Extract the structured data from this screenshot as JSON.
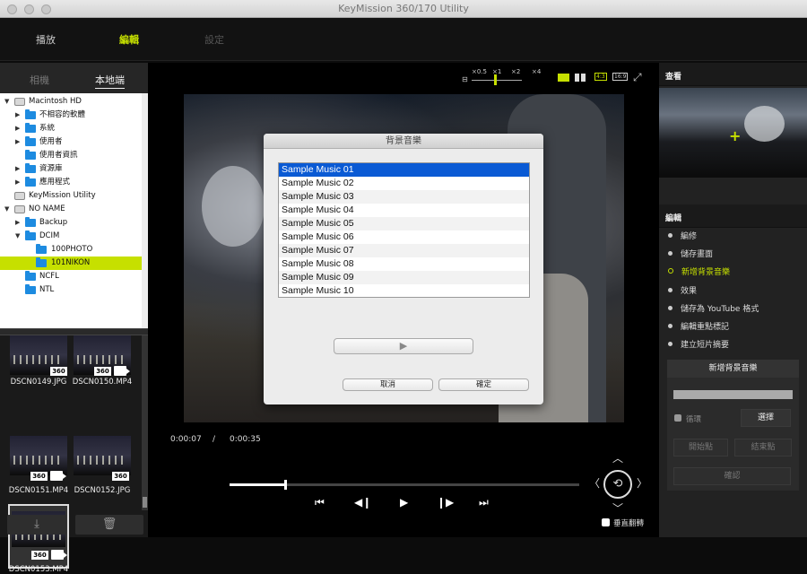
{
  "window": {
    "title": "KeyMission 360/170 Utility"
  },
  "main_tabs": [
    {
      "label": "播放",
      "state": "normal"
    },
    {
      "label": "編輯",
      "state": "active"
    },
    {
      "label": "設定",
      "state": "disabled"
    }
  ],
  "left": {
    "tabs": [
      "相機",
      "本地端"
    ],
    "tree": [
      {
        "label": "Macintosh HD",
        "icon": "drive-icon",
        "expanded": true
      },
      {
        "label": "不相容的軟體",
        "icon": "folder-icon"
      },
      {
        "label": "系統",
        "icon": "folder-icon"
      },
      {
        "label": "使用者",
        "icon": "folder-icon"
      },
      {
        "label": "使用者資訊",
        "icon": "folder-icon"
      },
      {
        "label": "資源庫",
        "icon": "folder-icon"
      },
      {
        "label": "應用程式",
        "icon": "folder-icon"
      },
      {
        "label": "KeyMission Utility",
        "icon": "drive-icon"
      },
      {
        "label": "NO NAME",
        "icon": "drive-icon",
        "expanded": true
      },
      {
        "label": "Backup",
        "icon": "folder-icon"
      },
      {
        "label": "DCIM",
        "icon": "folder-icon",
        "expanded": true
      },
      {
        "label": "100PHOTO",
        "icon": "folder-icon"
      },
      {
        "label": "101NIKON",
        "icon": "folder-icon",
        "selected": true
      },
      {
        "label": "NCFL",
        "icon": "folder-icon"
      },
      {
        "label": "NTL",
        "icon": "folder-icon"
      }
    ],
    "thumbnails": [
      {
        "name": "DSCN0149.JPG",
        "badge": "360",
        "video": false
      },
      {
        "name": "DSCN0150.MP4",
        "badge": "360",
        "video": true
      },
      {
        "name": "DSCN0151.MP4",
        "badge": "360",
        "video": true
      },
      {
        "name": "DSCN0152.JPG",
        "badge": "360",
        "video": false
      },
      {
        "name": "DSCN0153.MP4",
        "badge": "360",
        "video": true,
        "selected": true
      }
    ],
    "import_icon": "download-icon",
    "delete_icon": "trash-icon"
  },
  "viewer": {
    "zoom_labels": [
      "×0.5",
      "×1",
      "×2",
      "×4"
    ],
    "aspect_labels": [
      "4:3",
      "16:9"
    ],
    "time_current": "0:00:07",
    "time_separator": "/",
    "time_total": "0:00:35",
    "progress": 0.2,
    "controls": {
      "prev": "⏮",
      "step_back": "◀❙",
      "play": "▶",
      "step_fwd": "❙▶",
      "next": "⏭"
    },
    "flip_label": "垂直翻轉",
    "nav_center": "⟲"
  },
  "modal": {
    "title": "背景音樂",
    "items": [
      "Sample Music 01",
      "Sample Music 02",
      "Sample Music 03",
      "Sample Music 04",
      "Sample Music 05",
      "Sample Music 06",
      "Sample Music 07",
      "Sample Music 08",
      "Sample Music 09",
      "Sample Music 10"
    ],
    "selected_index": 0,
    "play_symbol": "▶",
    "cancel_label": "取消",
    "ok_label": "確定"
  },
  "right": {
    "view_header": "查看",
    "edit_header": "編輯",
    "edit_items": [
      {
        "label": "編修",
        "active": false
      },
      {
        "label": "儲存畫面",
        "active": false
      },
      {
        "label": "新增背景音樂",
        "active": true
      },
      {
        "label": "效果",
        "active": false
      },
      {
        "label": "儲存為 YouTube 格式",
        "active": false
      },
      {
        "label": "編輯重點標記",
        "active": false
      },
      {
        "label": "建立短片摘要",
        "active": false
      }
    ],
    "bgm_box": {
      "header": "新增背景音樂",
      "loop_label": "循環",
      "select_label": "選擇",
      "start_label": "開始點",
      "end_label": "結束點",
      "confirm_label": "確認"
    }
  },
  "colors": {
    "accent": "#c6e000",
    "selection": "#0a5ad4",
    "folder": "#1d8be0"
  }
}
